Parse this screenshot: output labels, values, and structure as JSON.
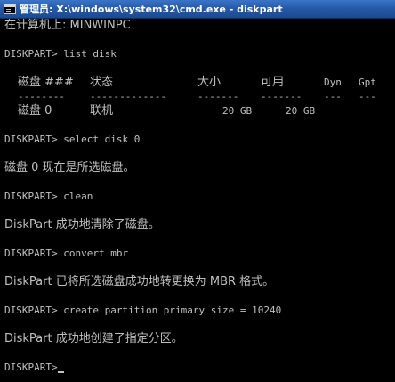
{
  "window": {
    "title": "管理员: X:\\windows\\system32\\cmd.exe - diskpart",
    "icon": "console-window-icon"
  },
  "console": {
    "computer_line": "在计算机上: MINWINPC",
    "cmd_list_disk": "DISKPART> list disk",
    "table": {
      "headers": [
        "磁盘 ###",
        "状态",
        "大小",
        "可用",
        "Dyn",
        "Gpt"
      ],
      "separators": [
        "--------",
        "-------------",
        "-------",
        "-------",
        "---",
        "---"
      ],
      "rows": [
        [
          "磁盘 0",
          "联机",
          "20 GB",
          "20 GB",
          "",
          ""
        ]
      ]
    },
    "cmd_select": "DISKPART> select disk 0",
    "msg_select": "磁盘 0 现在是所选磁盘。",
    "cmd_clean": "DISKPART> clean",
    "msg_clean": "DiskPart 成功地清除了磁盘。",
    "cmd_convert": "DISKPART> convert mbr",
    "msg_convert": "DiskPart 已将所选磁盘成功地转更换为 MBR 格式。",
    "cmd_create": "DISKPART> create partition primary size = 10240",
    "msg_create": "DiskPart 成功地创建了指定分区。",
    "prompt": "DISKPART>"
  }
}
